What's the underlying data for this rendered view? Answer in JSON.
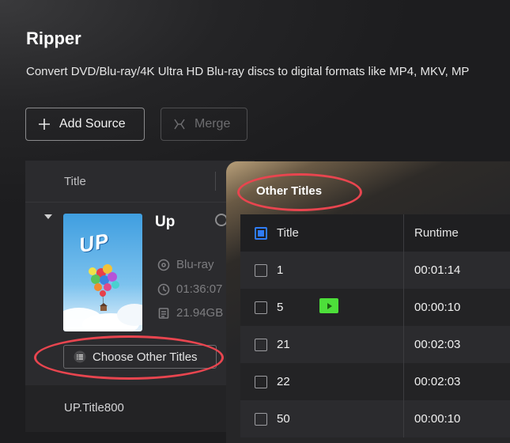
{
  "page": {
    "title": "Ripper",
    "subtitle": "Convert DVD/Blu-ray/4K Ultra HD Blu-ray discs to digital formats like MP4, MKV, MP"
  },
  "toolbar": {
    "add_source_label": "Add Source",
    "merge_label": "Merge"
  },
  "source_list": {
    "column_title": "Title",
    "item": {
      "name": "Up",
      "poster_text": "UP",
      "disc_type": "Blu-ray",
      "duration": "01:36:07",
      "size": "21.94GB",
      "choose_label": "Choose Other Titles"
    },
    "footer_title": "UP.Title800"
  },
  "other_titles": {
    "title": "Other Titles",
    "columns": [
      "Title",
      "Runtime"
    ],
    "header_checked": true,
    "rows": [
      {
        "title": "1",
        "runtime": "00:01:14",
        "checked": false,
        "playing": false
      },
      {
        "title": "5",
        "runtime": "00:00:10",
        "checked": false,
        "playing": true
      },
      {
        "title": "21",
        "runtime": "00:02:03",
        "checked": false,
        "playing": false
      },
      {
        "title": "22",
        "runtime": "00:02:03",
        "checked": false,
        "playing": false
      },
      {
        "title": "50",
        "runtime": "00:00:10",
        "checked": false,
        "playing": false
      }
    ]
  },
  "colors": {
    "accent": "#2f7cf6",
    "play_badge": "#4ddf3a",
    "annotation": "#e8454f"
  }
}
